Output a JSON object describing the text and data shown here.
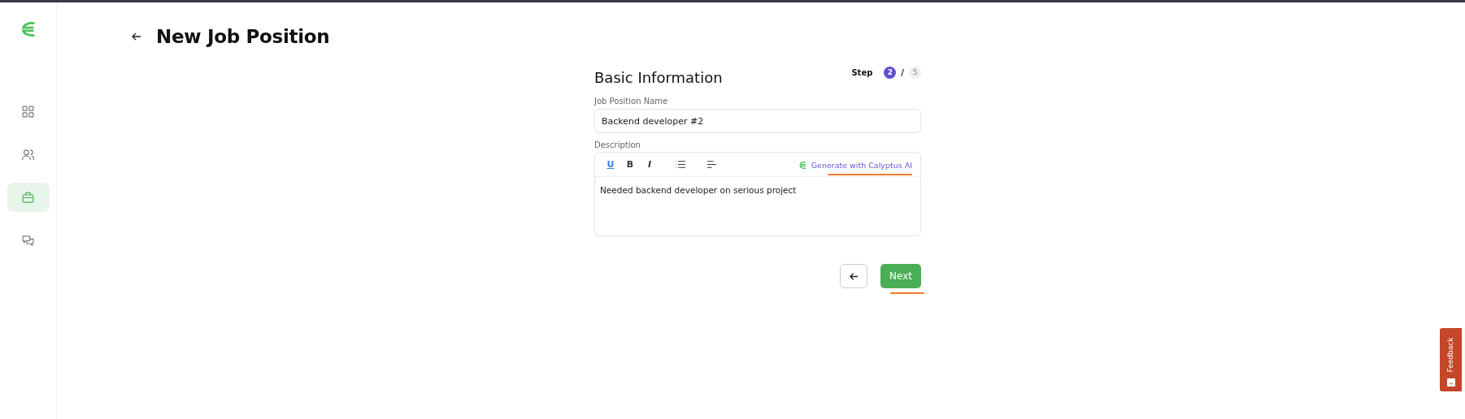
{
  "sidebar": {
    "items": [
      {
        "kind": "grid",
        "selected": false
      },
      {
        "kind": "users",
        "selected": false
      },
      {
        "kind": "briefcase",
        "selected": true
      },
      {
        "kind": "chat",
        "selected": false
      }
    ]
  },
  "header": {
    "title": "New Job Position"
  },
  "form": {
    "title": "Basic Information",
    "step": {
      "label": "Step",
      "current": "2",
      "separator": "/",
      "total": "5"
    },
    "name_field": {
      "label": "Job Position Name",
      "value": "Backend developer #2"
    },
    "description": {
      "label": "Description",
      "toolbar": [
        {
          "kind": "underline",
          "text": "U",
          "active": true
        },
        {
          "kind": "bold",
          "text": "B",
          "active": false
        },
        {
          "kind": "italic",
          "text": "I",
          "active": false
        },
        {
          "kind": "list",
          "active": false
        },
        {
          "kind": "align",
          "active": false
        }
      ],
      "ai_button": "Generate with Calyptus AI",
      "value": "Needed backend developer on serious project"
    },
    "buttons": {
      "next": "Next"
    }
  },
  "feedback": "Feedback"
}
